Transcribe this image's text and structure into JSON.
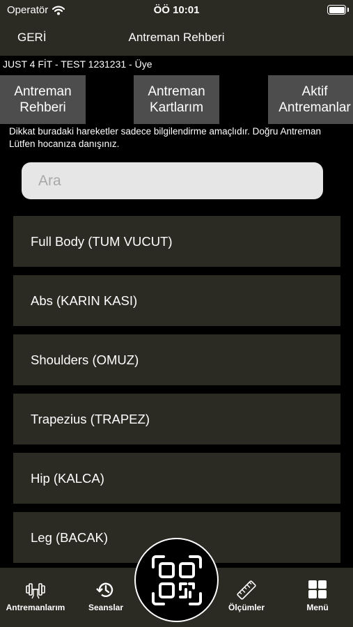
{
  "status_bar": {
    "carrier": "Operatör",
    "time": "ÖÖ 10:01"
  },
  "nav": {
    "back_label": "GERİ",
    "title": "Antreman Rehberi"
  },
  "member_line": "JUST 4 FİT - TEST 1231231 - Üye",
  "tabs": [
    {
      "line1": "Antreman",
      "line2": "Rehberi"
    },
    {
      "line1": "Antreman",
      "line2": "Kartlarım"
    },
    {
      "line1": "Aktif",
      "line2": "Antremanlar"
    }
  ],
  "disclaimer": "Dikkat buradaki hareketler sadece bilgilendirme amaçlıdır. Doğru Antreman Lütfen hocanıza danışınız.",
  "search": {
    "placeholder": "Ara",
    "value": ""
  },
  "list": [
    "Full Body (TUM VUCUT)",
    "Abs (KARIN KASI)",
    "Shoulders (OMUZ)",
    "Trapezius (TRAPEZ)",
    "Hip (KALCA)",
    "Leg (BACAK)"
  ],
  "tab_bar": [
    {
      "label": "Antremanlarım",
      "icon": "dumbbell-icon"
    },
    {
      "label": "Seanslar",
      "icon": "history-icon"
    },
    {
      "label": "",
      "icon": "qr-code-icon"
    },
    {
      "label": "Ölçümler",
      "icon": "ruler-icon"
    },
    {
      "label": "Menü",
      "icon": "grid-icon"
    }
  ]
}
